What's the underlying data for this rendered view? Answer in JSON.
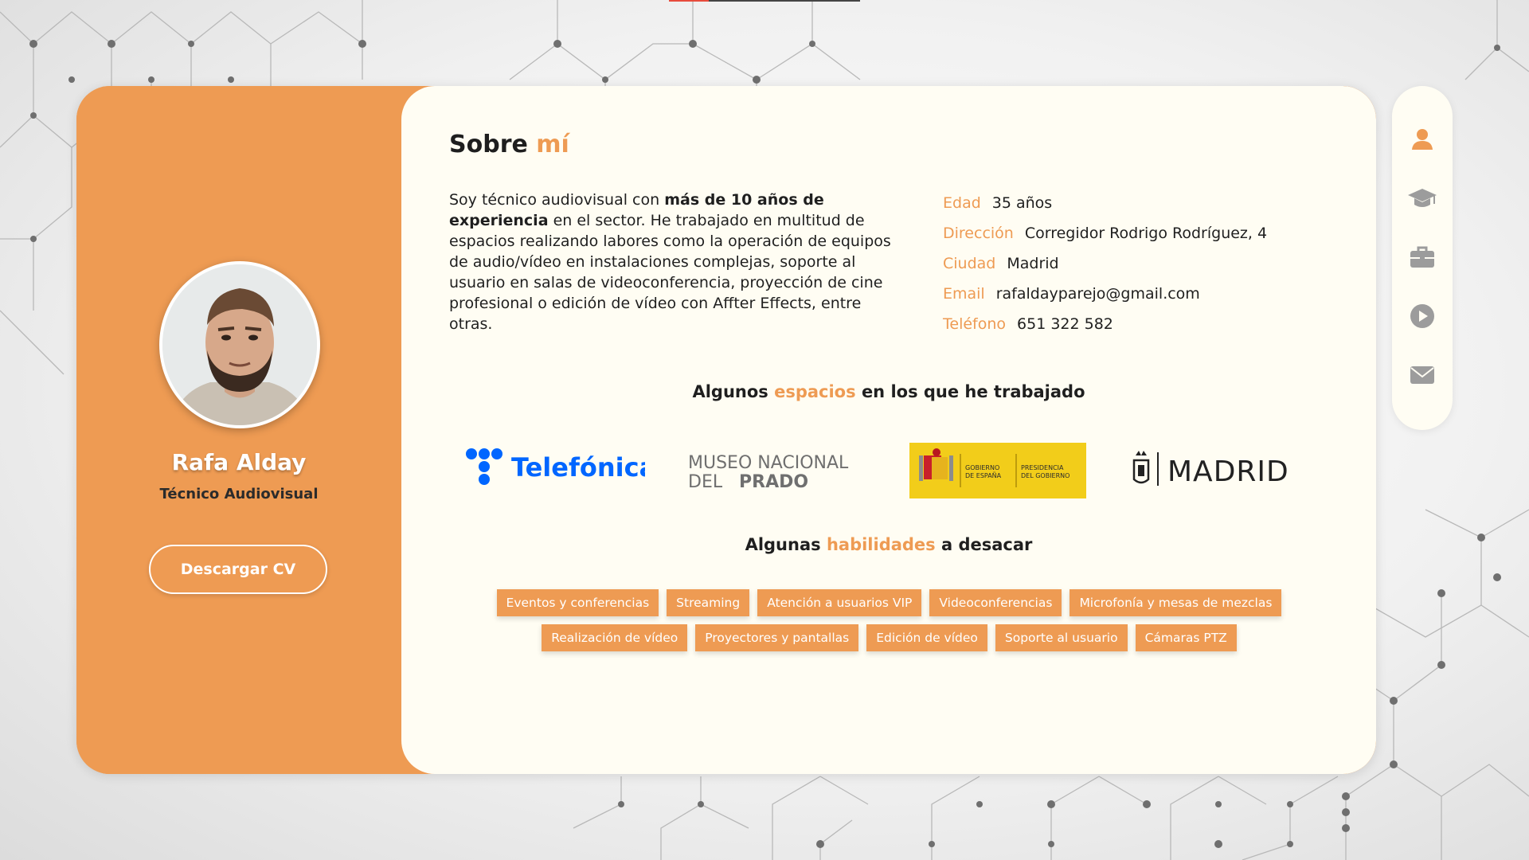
{
  "colors": {
    "accent": "#ee9b53",
    "content_bg": "#fffdf3",
    "text": "#1f1f1f"
  },
  "profile": {
    "name": "Rafa Alday",
    "role": "Técnico Audiovisual",
    "cv_button": "Descargar CV"
  },
  "about": {
    "title_prefix": "Sobre",
    "title_highlight": "mí",
    "bio": {
      "part1": "Soy técnico audiovisual con ",
      "bold1": "más de 10 años de experiencia",
      "part2": " en el sector. He trabajado en multitud de espacios realizando labores como la operación de equipos de audio/vídeo en instalaciones complejas, soporte al usuario en salas de videoconferencia, proyección de cine profesional o edición de vídeo con Affter Effects, entre otras."
    },
    "info": [
      {
        "label": "Edad",
        "value": "35 años"
      },
      {
        "label": "Dirección",
        "value": "Corregidor Rodrigo Rodríguez, 4"
      },
      {
        "label": "Ciudad",
        "value": "Madrid"
      },
      {
        "label": "Email",
        "value": "rafaldayparejo@gmail.com"
      },
      {
        "label": "Teléfono",
        "value": "651 322 582"
      }
    ]
  },
  "workplaces": {
    "heading_prefix": "Algunos",
    "heading_highlight": "espacios",
    "heading_suffix": "en los que he trabajado",
    "logos": {
      "telefonica": "Telefónica",
      "prado_line1": "MUSEO NACIONAL",
      "prado_line2a": "DEL",
      "prado_line2b": "PRADO",
      "gobierno_a1": "GOBIERNO",
      "gobierno_a2": "DE ESPAÑA",
      "gobierno_b1": "PRESIDENCIA",
      "gobierno_b2": "DEL GOBIERNO",
      "madrid": "MADRID"
    }
  },
  "skills": {
    "heading_prefix": "Algunas",
    "heading_highlight": "habilidades",
    "heading_suffix": "a desacar",
    "row1": [
      "Eventos y conferencias",
      "Streaming",
      "Atención a usuarios VIP",
      "Videoconferencias",
      "Microfonía y mesas de mezclas"
    ],
    "row2": [
      "Realización de vídeo",
      "Proyectores y pantallas",
      "Edición de vídeo",
      "Soporte al usuario",
      "Cámaras PTZ"
    ]
  },
  "nav": {
    "icons": [
      "user-icon",
      "graduation-cap-icon",
      "briefcase-icon",
      "play-icon",
      "envelope-icon"
    ]
  }
}
